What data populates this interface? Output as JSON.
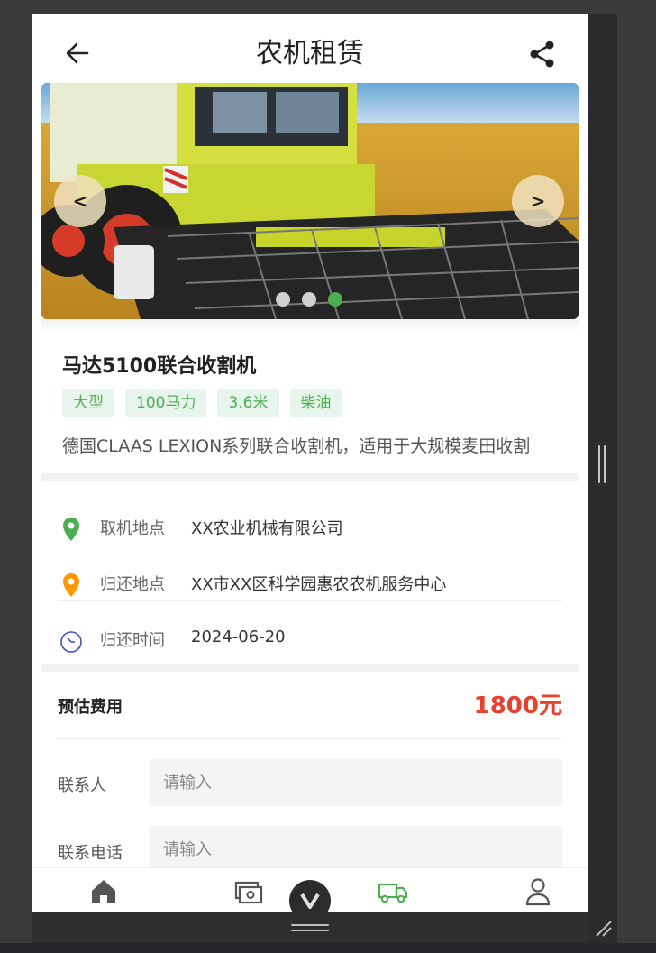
{
  "header": {
    "title": "农机租赁",
    "back_icon": "arrow-left-icon",
    "share_icon": "share-icon"
  },
  "carousel": {
    "prev_label": "<",
    "next_label": ">",
    "slide_count": 3,
    "active_index": 2,
    "active_color": "#4caf50",
    "inactive_color": "#d0d0d0"
  },
  "product": {
    "name": "马达5100联合收割机",
    "tags": [
      "大型",
      "100马力",
      "3.6米",
      "柴油"
    ],
    "description": "德国CLAAS LEXION系列联合收割机，适用于大规模麦田收割"
  },
  "info": {
    "pickup": {
      "label": "取机地点",
      "value": "XX农业机械有限公司",
      "icon": "location-pin-icon",
      "color": "#4caf50"
    },
    "return_place": {
      "label": "归还地点",
      "value": "XX市XX区科学园惠农农机服务中心",
      "icon": "location-pin-icon",
      "color": "#ff9800"
    },
    "return_time": {
      "label": "归还时间",
      "value": "2024-06-20",
      "icon": "clock-icon",
      "color": "#3f51b5"
    }
  },
  "fee": {
    "label": "预估费用",
    "value": "1800元",
    "color": "#e8412e"
  },
  "form": {
    "contact": {
      "label": "联系人",
      "placeholder": "请输入"
    },
    "phone": {
      "label": "联系电话",
      "placeholder": "请输入"
    }
  },
  "tabbar": {
    "items": [
      {
        "icon": "home-icon",
        "color": "#555555"
      },
      {
        "icon": "money-icon",
        "color": "#555555"
      },
      {
        "icon": "truck-icon",
        "color": "#4caf50"
      },
      {
        "icon": "user-icon",
        "color": "#555555"
      }
    ],
    "fab_icon": "chevron-down-icon"
  }
}
